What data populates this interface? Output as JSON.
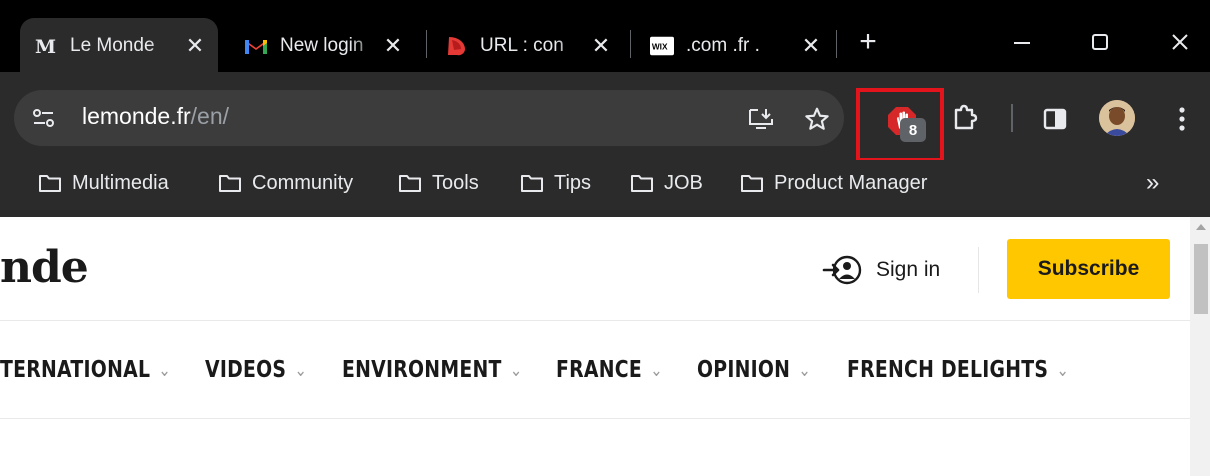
{
  "tabs": [
    {
      "title": "Le Monde",
      "favicon": "le-monde-icon",
      "active": true
    },
    {
      "title": "New login",
      "favicon": "gmail-icon",
      "active": false
    },
    {
      "title": "URL : con",
      "favicon": "red-shape-icon",
      "active": false
    },
    {
      "title": ".com .fr .",
      "favicon": "wix-icon",
      "active": false
    }
  ],
  "new_tab_label": "+",
  "window_controls": [
    "minimize-icon",
    "maximize-icon",
    "close-icon"
  ],
  "address_bar": {
    "host": "lemonde.fr",
    "path": "/en/"
  },
  "extension": {
    "badge": "8",
    "icon": "adblock-hand-icon"
  },
  "bookmarks": [
    "Multimedia",
    "Community",
    "Tools",
    "Tips",
    "JOB",
    "Product Manager"
  ],
  "bookmarks_overflow": "»",
  "page": {
    "logo_fragment": "nde",
    "signin_label": "Sign in",
    "subscribe_label": "Subscribe",
    "nav": [
      "TERNATIONAL",
      "VIDEOS",
      "ENVIRONMENT",
      "FRANCE",
      "OPINION",
      "FRENCH DELIGHTS"
    ],
    "chevron": "⌄"
  },
  "colors": {
    "subscribe_bg": "#ffc700",
    "highlight": "#e3141c",
    "toolbar_bg": "#2b2b2b"
  }
}
